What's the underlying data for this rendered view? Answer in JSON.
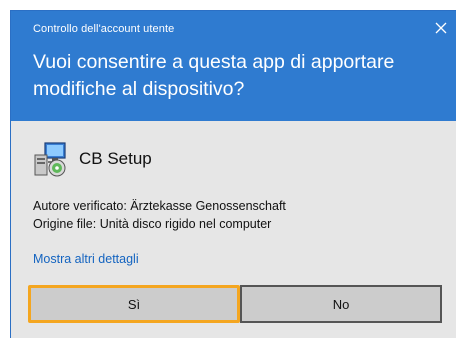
{
  "dialog": {
    "window_title": "Controllo dell'account utente",
    "close_icon": "close-icon",
    "question": "Vuoi consentire a questa app di apportare modifiche al dispositivo?",
    "header_color": "#2f7bd0",
    "body_color": "#e6e6e6"
  },
  "app": {
    "icon": "setup-installer-icon",
    "name": "CB Setup"
  },
  "details": {
    "publisher": "Autore verificato: Ärztekasse Genossenschaft",
    "origin": "Origine file: Unità disco rigido nel computer"
  },
  "more_details_link": "Mostra altri dettagli",
  "buttons": {
    "yes_label": "Sì",
    "no_label": "No",
    "focus_color": "#f4a620"
  }
}
